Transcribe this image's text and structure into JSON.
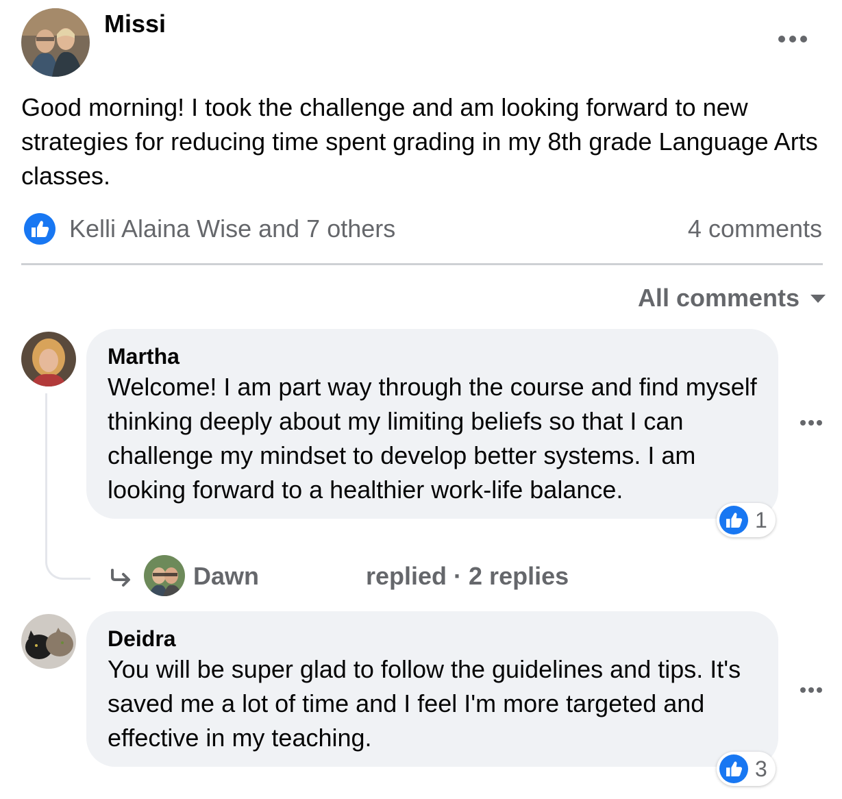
{
  "post": {
    "author": "Missi",
    "text": "Good morning! I took the challenge and am looking forward to new strategies for reducing time spent grading in my 8th grade Language Arts classes.",
    "reactions_text": "Kelli Alaina Wise and 7 others",
    "comments_count": "4 comments"
  },
  "comments_sort": "All comments",
  "comments": [
    {
      "author": "Martha",
      "text": "Welcome! I am part way through the course and find myself thinking deeply about my limiting beliefs so that I can challenge my mindset to develop better systems. I am looking forward to a healthier work-life balance.",
      "like_count": "1",
      "reply_summary": {
        "name": "Dawn",
        "text": "replied · 2 replies"
      }
    },
    {
      "author": "Deidra",
      "text": "You will be super glad to follow the guidelines and tips. It's saved me a lot of time and I feel I'm more targeted and effective in my teaching.",
      "like_count": "3"
    }
  ],
  "icons": {
    "post_menu": "more-horizontal-icon",
    "like": "like-thumb-icon",
    "sort_caret": "caret-down-icon",
    "reply_arrow": "reply-arrow-icon"
  },
  "colors": {
    "like_blue": "#1877f2",
    "secondary_text": "#65676b",
    "bubble_bg": "#f0f2f5",
    "divider": "#ced0d4"
  }
}
